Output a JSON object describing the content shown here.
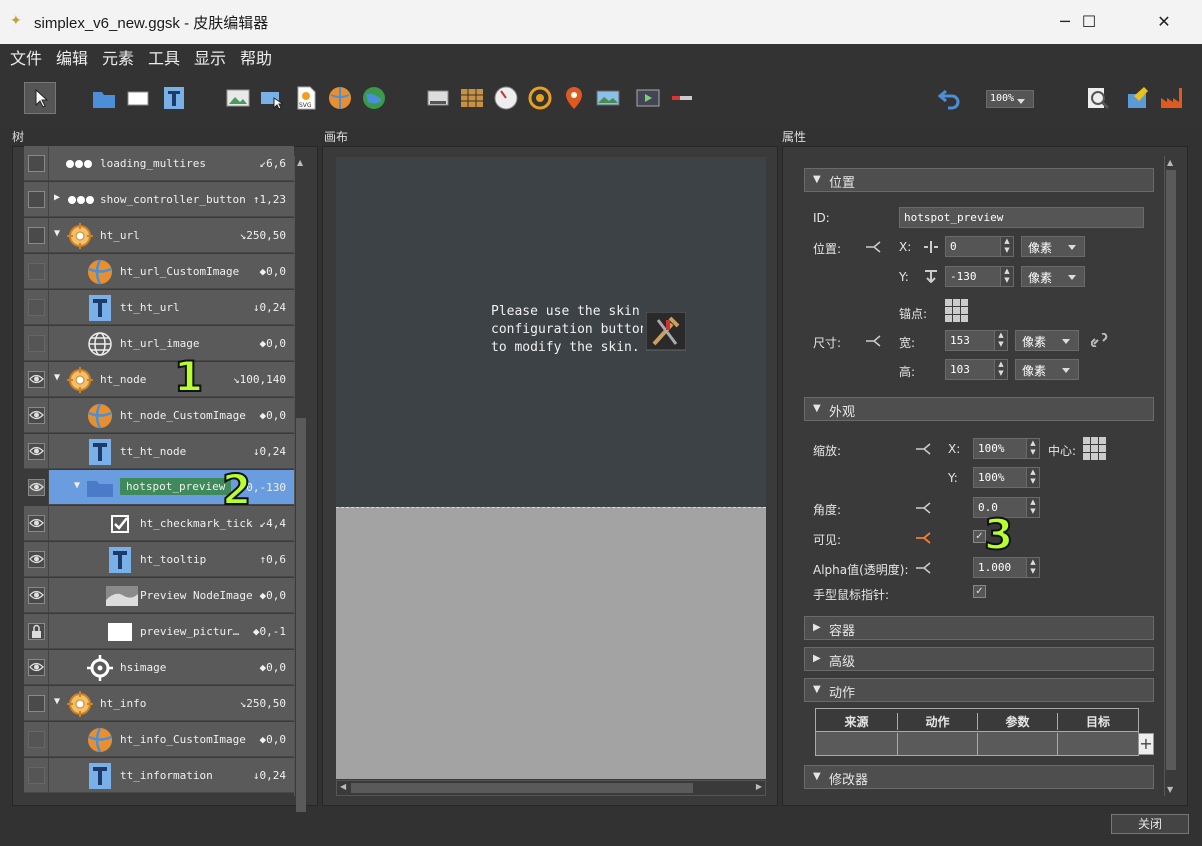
{
  "window": {
    "title": "simplex_v6_new.ggsk - 皮肤编辑器",
    "minimize": "─",
    "maximize": "☐",
    "close": "✕"
  },
  "menu": [
    "文件",
    "编辑",
    "元素",
    "工具",
    "显示",
    "帮助"
  ],
  "toolbar": {
    "zoom": "100%"
  },
  "sections": {
    "tree": "树",
    "canvas": "画布",
    "properties": "属性"
  },
  "tree": [
    {
      "label": "loading_multires",
      "coord": "↙6,6",
      "icon": "dots-icon",
      "indent": 0,
      "state": "check"
    },
    {
      "label": "show_controller_button",
      "coord": "↑1,23",
      "icon": "dots-icon",
      "indent": 0,
      "state": "check",
      "arrow": "▶"
    },
    {
      "label": "ht_url",
      "coord": "↘250,50",
      "icon": "crosshair-icon",
      "indent": 0,
      "state": "check",
      "arrow": "▼"
    },
    {
      "label": "ht_url_CustomImage",
      "coord": "◆0,0",
      "icon": "globe-icon",
      "indent": 1,
      "state": "eye-off"
    },
    {
      "label": "tt_ht_url",
      "coord": "↓0,24",
      "icon": "text-icon",
      "indent": 1,
      "state": "eye-off"
    },
    {
      "label": "ht_url_image",
      "coord": "◆0,0",
      "icon": "web-icon",
      "indent": 1,
      "state": "eye-off"
    },
    {
      "label": "ht_node",
      "coord": "↘100,140",
      "icon": "crosshair-icon",
      "indent": 0,
      "state": "eye",
      "arrow": "▼"
    },
    {
      "label": "ht_node_CustomImage",
      "coord": "◆0,0",
      "icon": "globe-icon",
      "indent": 1,
      "state": "eye"
    },
    {
      "label": "tt_ht_node",
      "coord": "↓0,24",
      "icon": "text-icon",
      "indent": 1,
      "state": "eye"
    },
    {
      "label": "hotspot_preview",
      "coord": "↓0,-130",
      "icon": "folder-icon",
      "indent": 1,
      "state": "eye",
      "arrow": "▼",
      "selected": true
    },
    {
      "label": "ht_checkmark_tick",
      "coord": "↙4,4",
      "icon": "checkbox-icon",
      "indent": 2,
      "state": "eye"
    },
    {
      "label": "ht_tooltip",
      "coord": "↑0,6",
      "icon": "text-icon",
      "indent": 2,
      "state": "eye"
    },
    {
      "label": "Preview NodeImage",
      "coord": "◆0,0",
      "icon": "image-icon",
      "indent": 2,
      "state": "eye"
    },
    {
      "label": "preview_pictur…",
      "coord": "◆0,-1",
      "icon": "rect-icon",
      "indent": 2,
      "state": "lock"
    },
    {
      "label": "hsimage",
      "coord": "◆0,0",
      "icon": "target-icon",
      "indent": 1,
      "state": "eye"
    },
    {
      "label": "ht_info",
      "coord": "↘250,50",
      "icon": "crosshair-icon",
      "indent": 0,
      "state": "check",
      "arrow": "▼"
    },
    {
      "label": "ht_info_CustomImage",
      "coord": "◆0,0",
      "icon": "globe-icon",
      "indent": 1,
      "state": "eye-off"
    },
    {
      "label": "tt_information",
      "coord": "↓0,24",
      "icon": "text-icon",
      "indent": 1,
      "state": "eye-off"
    }
  ],
  "annotations": [
    "1",
    "2",
    "3"
  ],
  "canvas": {
    "message_lines": [
      "Please use the skin",
      "configuration button",
      "to modify the skin."
    ]
  },
  "props": {
    "position_header": "位置",
    "id_label": "ID:",
    "id_value": "hotspot_preview",
    "pos_label": "位置:",
    "x_label": "X:",
    "x_value": "0",
    "y_label": "Y:",
    "y_value": "-130",
    "unit": "像素",
    "anchor_label": "锚点:",
    "size_label": "尺寸:",
    "width_label": "宽:",
    "width_value": "153",
    "height_label": "高:",
    "height_value": "103",
    "appearance_header": "外观",
    "scale_label": "缩放:",
    "scale_x": "100%",
    "scale_y": "100%",
    "center_label": "中心:",
    "angle_label": "角度:",
    "angle_value": "0.0",
    "visible_label": "可见:",
    "alpha_label": "Alpha值(透明度):",
    "alpha_value": "1.000",
    "cursor_label": "手型鼠标指针:",
    "container_header": "容器",
    "advanced_header": "高级",
    "actions_header": "动作",
    "actions_cols": [
      "来源",
      "动作",
      "参数",
      "目标"
    ],
    "modifiers_header": "修改器"
  },
  "close_button": "关闭"
}
